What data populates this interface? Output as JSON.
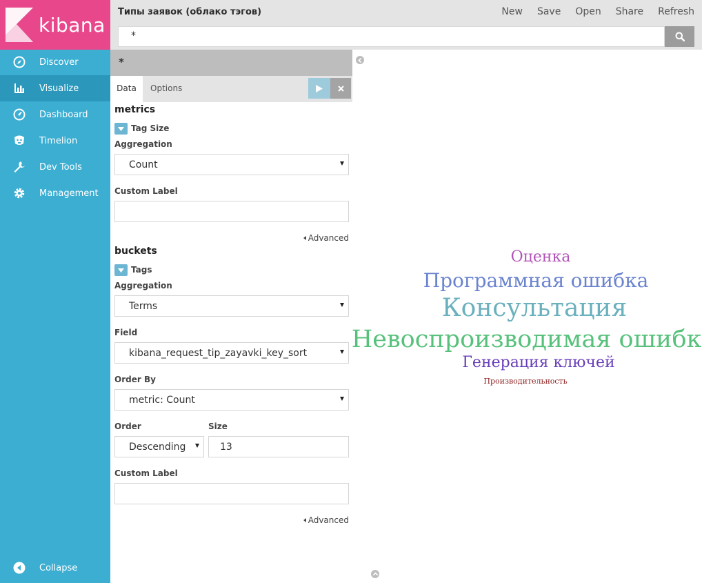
{
  "brand": {
    "name": "kibana"
  },
  "sidebar": {
    "items": [
      {
        "label": "Discover",
        "icon": "compass-icon"
      },
      {
        "label": "Visualize",
        "icon": "bar-chart-icon",
        "active": true
      },
      {
        "label": "Dashboard",
        "icon": "dashboard-icon"
      },
      {
        "label": "Timelion",
        "icon": "timelion-icon"
      },
      {
        "label": "Dev Tools",
        "icon": "wrench-icon"
      },
      {
        "label": "Management",
        "icon": "gear-icon"
      }
    ],
    "collapse_label": "Collapse"
  },
  "header": {
    "title": "Типы заявок (облако тэгов)",
    "menu": {
      "new": "New",
      "save": "Save",
      "open": "Open",
      "share": "Share",
      "refresh": "Refresh"
    },
    "query": "*"
  },
  "editor": {
    "index_pattern": "*",
    "tabs": {
      "data": "Data",
      "options": "Options"
    },
    "metrics": {
      "title": "metrics",
      "agg_name": "Tag Size",
      "aggregation_label": "Aggregation",
      "aggregation_value": "Count",
      "custom_label_label": "Custom Label",
      "custom_label_value": "",
      "advanced": "Advanced"
    },
    "buckets": {
      "title": "buckets",
      "agg_name": "Tags",
      "aggregation_label": "Aggregation",
      "aggregation_value": "Terms",
      "field_label": "Field",
      "field_value": "kibana_request_tip_zayavki_key_sort",
      "order_by_label": "Order By",
      "order_by_value": "metric: Count",
      "order_label": "Order",
      "order_value": "Descending",
      "size_label": "Size",
      "size_value": "13",
      "custom_label_label": "Custom Label",
      "custom_label_value": "",
      "advanced": "Advanced"
    }
  },
  "tag_cloud": {
    "tags": [
      {
        "text": "Оценка",
        "color": "#b253b8"
      },
      {
        "text": "Программная ошибка",
        "color": "#6a83cf"
      },
      {
        "text": "Консультация",
        "color": "#6ab0bd"
      },
      {
        "text": "Невоспроизводимая ошибка",
        "color": "#57c17b"
      },
      {
        "text": "Генерация ключей",
        "color": "#663db8"
      },
      {
        "text": "Производительность",
        "color": "#8b1a1a"
      }
    ]
  }
}
